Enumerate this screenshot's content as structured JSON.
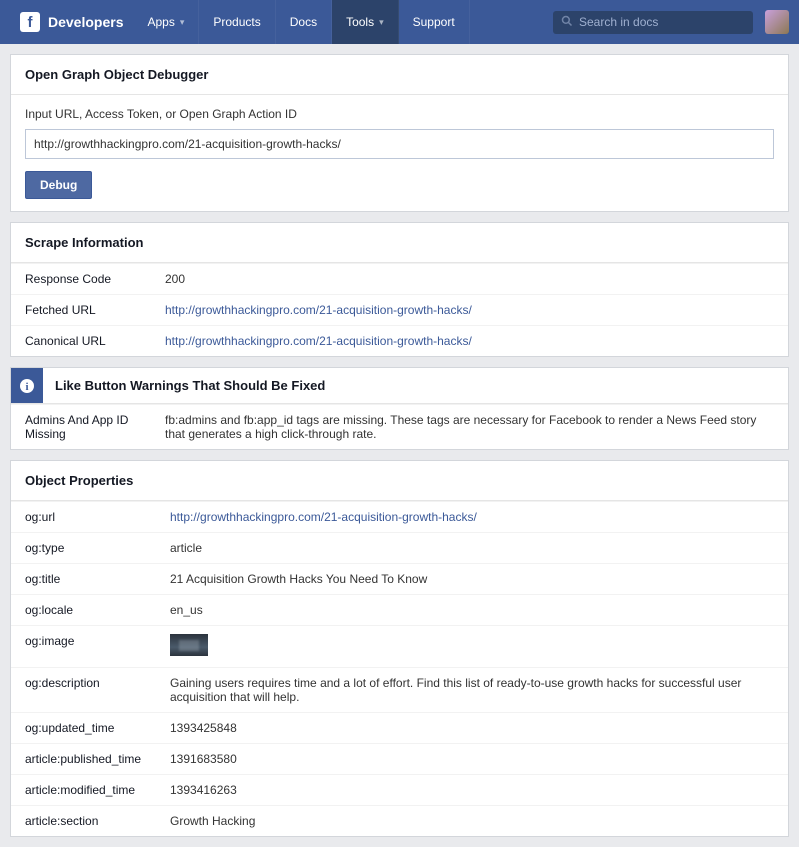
{
  "nav": {
    "brand": "Developers",
    "items": [
      {
        "label": "Apps",
        "dropdown": true
      },
      {
        "label": "Products"
      },
      {
        "label": "Docs"
      },
      {
        "label": "Tools",
        "dropdown": true,
        "active": true
      },
      {
        "label": "Support"
      }
    ],
    "search_placeholder": "Search in docs"
  },
  "debugger": {
    "title": "Open Graph Object Debugger",
    "input_label": "Input URL, Access Token, or Open Graph Action ID",
    "input_value": "http://growthhackingpro.com/21-acquisition-growth-hacks/",
    "button": "Debug"
  },
  "scrape": {
    "title": "Scrape Information",
    "rows": [
      {
        "key": "Response Code",
        "val": "200"
      },
      {
        "key": "Fetched URL",
        "val": "http://growthhackingpro.com/21-acquisition-growth-hacks/",
        "link": true
      },
      {
        "key": "Canonical URL",
        "val": "http://growthhackingpro.com/21-acquisition-growth-hacks/",
        "link": true
      }
    ]
  },
  "warnings": {
    "header": "Like Button Warnings That Should Be Fixed",
    "rows": [
      {
        "key": "Admins And App ID Missing",
        "val": "fb:admins and fb:app_id tags are missing. These tags are necessary for Facebook to render a News Feed story that generates a high click-through rate."
      }
    ]
  },
  "properties": {
    "title": "Object Properties",
    "rows": [
      {
        "key": "og:url",
        "val": "http://growthhackingpro.com/21-acquisition-growth-hacks/",
        "link": true
      },
      {
        "key": "og:type",
        "val": "article"
      },
      {
        "key": "og:title",
        "val": "21 Acquisition Growth Hacks You Need To Know"
      },
      {
        "key": "og:locale",
        "val": "en_us"
      },
      {
        "key": "og:image",
        "val": "",
        "image": true
      },
      {
        "key": "og:description",
        "val": "Gaining users requires time and a lot of effort. Find this list of ready-to-use growth hacks for successful user acquisition that will help."
      },
      {
        "key": "og:updated_time",
        "val": "1393425848"
      },
      {
        "key": "article:published_time",
        "val": "1391683580"
      },
      {
        "key": "article:modified_time",
        "val": "1393416263"
      },
      {
        "key": "article:section",
        "val": "Growth Hacking"
      }
    ]
  }
}
